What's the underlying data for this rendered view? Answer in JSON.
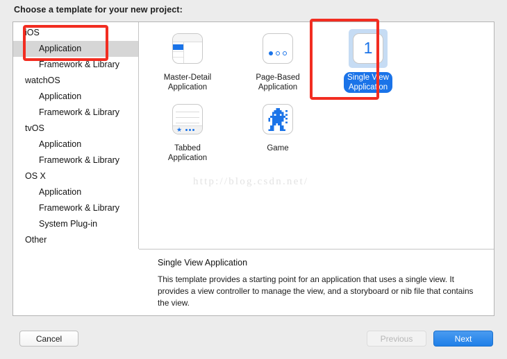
{
  "header": {
    "prompt": "Choose a template for your new project:"
  },
  "sidebar": {
    "rows": [
      {
        "label": "iOS",
        "level": "group",
        "selected": false
      },
      {
        "label": "Application",
        "level": "child",
        "selected": true
      },
      {
        "label": "Framework & Library",
        "level": "child",
        "selected": false
      },
      {
        "label": "watchOS",
        "level": "group",
        "selected": false
      },
      {
        "label": "Application",
        "level": "child",
        "selected": false
      },
      {
        "label": "Framework & Library",
        "level": "child",
        "selected": false
      },
      {
        "label": "tvOS",
        "level": "group",
        "selected": false
      },
      {
        "label": "Application",
        "level": "child",
        "selected": false
      },
      {
        "label": "Framework & Library",
        "level": "child",
        "selected": false
      },
      {
        "label": "OS X",
        "level": "group",
        "selected": false
      },
      {
        "label": "Application",
        "level": "child",
        "selected": false
      },
      {
        "label": "Framework & Library",
        "level": "child",
        "selected": false
      },
      {
        "label": "System Plug-in",
        "level": "child",
        "selected": false
      },
      {
        "label": "Other",
        "level": "group",
        "selected": false
      }
    ]
  },
  "templates": [
    {
      "label_line1": "Master-Detail",
      "label_line2": "Application",
      "icon": "master-detail-icon",
      "selected": false
    },
    {
      "label_line1": "Page-Based",
      "label_line2": "Application",
      "icon": "page-based-icon",
      "selected": false
    },
    {
      "label_line1": "Single View",
      "label_line2": "Application",
      "icon": "single-view-icon",
      "selected": true
    },
    {
      "label_line1": "Tabbed",
      "label_line2": "Application",
      "icon": "tabbed-icon",
      "selected": false
    },
    {
      "label_line1": "Game",
      "label_line2": "",
      "icon": "game-sprite-icon",
      "selected": false
    }
  ],
  "watermark": {
    "text": "http://blog.csdn.net/"
  },
  "description": {
    "title": "Single View Application",
    "body": "This template provides a starting point for an application that uses a single view. It provides a view controller to manage the view, and a storyboard or nib file that contains the view."
  },
  "footer": {
    "cancel_label": "Cancel",
    "previous_label": "Previous",
    "next_label": "Next"
  },
  "colors": {
    "accent_blue": "#1a73e8",
    "selection_tint": "#c6dcf4",
    "annotation_red": "#f22d21",
    "row_highlight": "#d6d6d6"
  }
}
